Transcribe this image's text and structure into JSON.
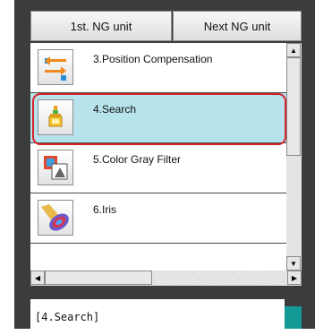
{
  "toolbar": {
    "first_ng_label": "1st. NG unit",
    "next_ng_label": "Next NG unit"
  },
  "units": [
    {
      "label": "3.Position Compensation",
      "icon": "position-compensation-icon",
      "selected": false
    },
    {
      "label": "4.Search",
      "icon": "search-unit-icon",
      "selected": true
    },
    {
      "label": "5.Color Gray Filter",
      "icon": "color-gray-filter-icon",
      "selected": false
    },
    {
      "label": "6.Iris",
      "icon": "iris-icon",
      "selected": false
    }
  ],
  "status": {
    "text": "[4.Search]",
    "indicator_color": "#129a96"
  },
  "colors": {
    "selection_bg": "#b7e3ec",
    "selection_ring": "#d4222a"
  }
}
